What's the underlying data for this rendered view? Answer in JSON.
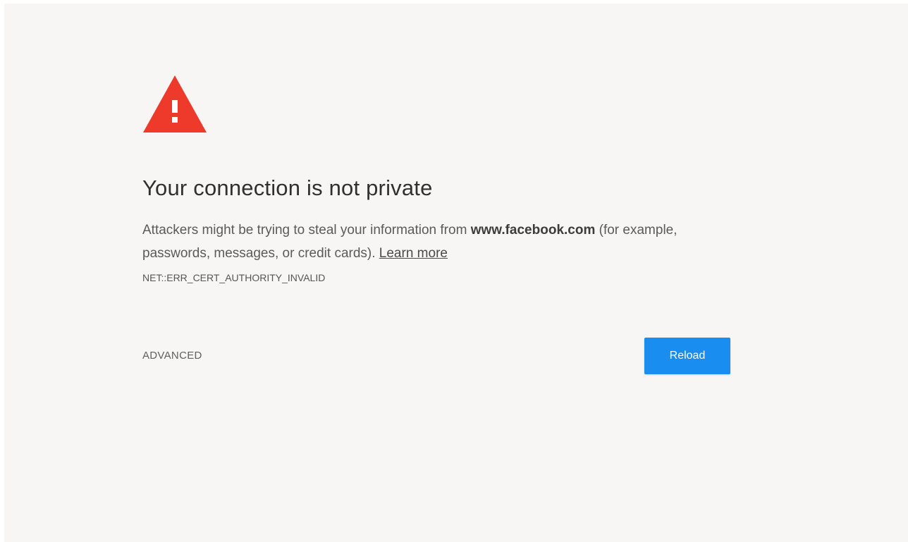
{
  "interstitial": {
    "icon": "warning-triangle-icon",
    "icon_color": "#ee3a2b",
    "title": "Your connection is not private",
    "message_prefix": "Attackers might be trying to steal your information from ",
    "site": "www.facebook.com",
    "message_suffix": " (for example, passwords, messages, or credit cards). ",
    "learn_more": "Learn more",
    "error_code": "NET::ERR_CERT_AUTHORITY_INVALID"
  },
  "actions": {
    "advanced_label": "ADVANCED",
    "reload_label": "Reload",
    "reload_color": "#1a8df0"
  }
}
